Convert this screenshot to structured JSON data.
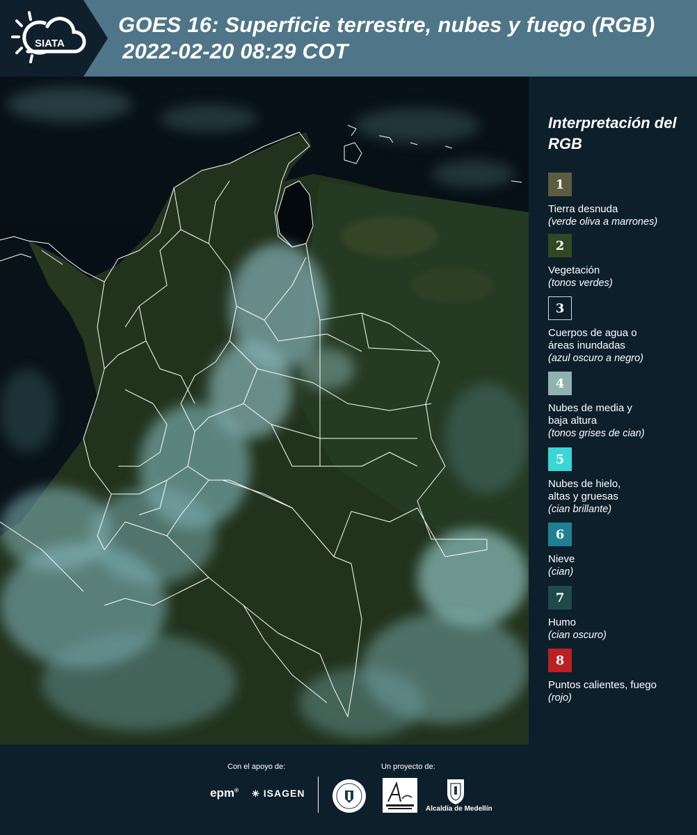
{
  "header": {
    "logo_text": "SIATA",
    "title_line1": "GOES 16: Superficie terrestre, nubes y fuego (RGB)",
    "title_line2": "2022-02-20 08:29 COT"
  },
  "legend": {
    "title": "Interpretación del RGB",
    "items": [
      {
        "number": "1",
        "label": "Tierra desnuda",
        "desc": "(verde oliva a marrones)",
        "color": "#5e5c40",
        "border": "#5e5c40"
      },
      {
        "number": "2",
        "label": "Vegetación",
        "desc": "(tonos verdes)",
        "color": "#2f4823",
        "border": "#2f4823"
      },
      {
        "number": "3",
        "label": "Cuerpos de agua o áreas inundadas",
        "desc": "(azul oscuro a negro)",
        "color": "#0d1f2b",
        "border": "#d8d8d8"
      },
      {
        "number": "4",
        "label": "Nubes de media y baja altura",
        "desc": "(tonos grises de cian)",
        "color": "#8fb1b1",
        "border": "#8fb1b1"
      },
      {
        "number": "5",
        "label": "Nubes de hielo, altas y gruesas",
        "desc": "(cian brillante)",
        "color": "#38d7d6",
        "border": "#38d7d6"
      },
      {
        "number": "6",
        "label": "Nieve",
        "desc": "(cian)",
        "color": "#1f8095",
        "border": "#1f8095"
      },
      {
        "number": "7",
        "label": "Humo",
        "desc": "(cian oscuro)",
        "color": "#1e4a4b",
        "border": "#1e4a4b"
      },
      {
        "number": "8",
        "label": "Puntos calientes, fuego",
        "desc": "(rojo)",
        "color": "#bb2025",
        "border": "#bb2025"
      }
    ]
  },
  "footer": {
    "support_caption": "Con el apoyo de:",
    "project_caption": "Un proyecto de:",
    "sponsor_epm": "epm",
    "sponsor_isagen": "ISAGEN",
    "alcaldia": "Alcaldía de Medellín"
  },
  "colors": {
    "header_band": "#4f7588",
    "background": "#0d1f2b",
    "ocean": "#050d12",
    "vegetation": "#24361f",
    "cloud": "#7fb7bb",
    "border_lines": "#ffffff"
  }
}
